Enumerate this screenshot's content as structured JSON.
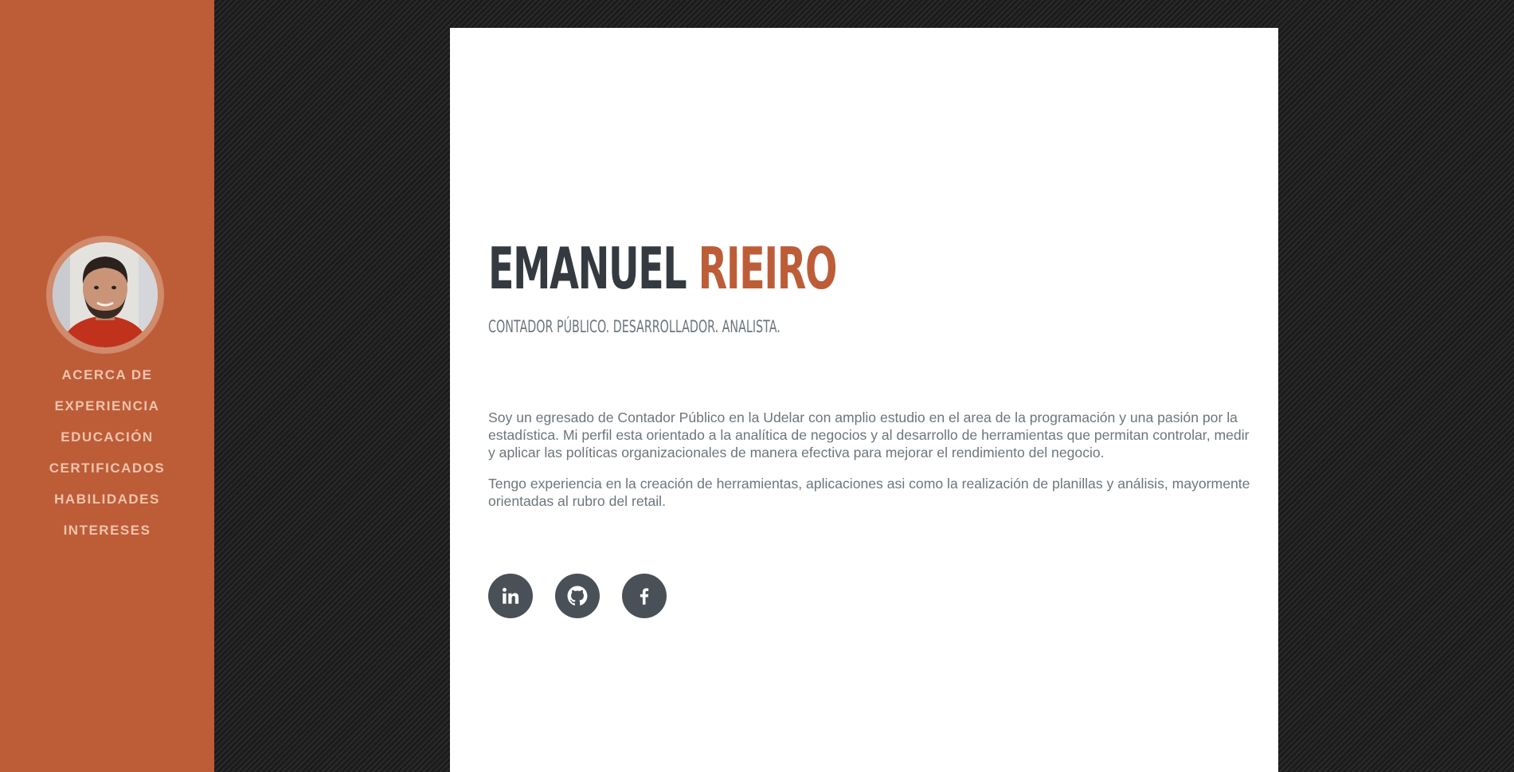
{
  "nav": {
    "items": [
      {
        "label": "ACERCA DE"
      },
      {
        "label": "EXPERIENCIA"
      },
      {
        "label": "EDUCACIÓN"
      },
      {
        "label": "CERTIFICADOS"
      },
      {
        "label": "HABILIDADES"
      },
      {
        "label": "INTERESES"
      }
    ]
  },
  "about": {
    "first_name": "EMANUEL",
    "last_name": "RIEIRO",
    "subheading": "CONTADOR PÚBLICO. DESARROLLADOR. ANALISTA.",
    "paragraphs": [
      "Soy un egresado de Contador Público en la Udelar con amplio estudio en el area de la programación y una pasión por la estadística. Mi perfil esta orientado a la analítica de negocios y al desarrollo de herramientas que permitan controlar, medir y aplicar las políticas organizacionales de manera efectiva para mejorar el rendimiento del negocio.",
      "Tengo experiencia en la creación de herramientas, aplicaciones asi como la realización de planillas y análisis, mayormente orientadas al rubro del retail."
    ]
  },
  "social": {
    "icons": [
      "linkedin-icon",
      "github-icon",
      "facebook-icon"
    ]
  },
  "colors": {
    "accent": "#bd5d38",
    "heading": "#343a40",
    "text": "#6c757d",
    "social_bg": "#495057",
    "nav_text": "#f0c3ad"
  }
}
